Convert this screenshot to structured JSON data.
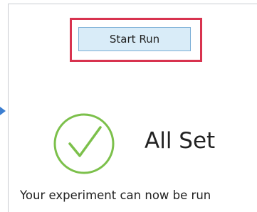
{
  "toolbar": {
    "start_run_label": "Start Run"
  },
  "status": {
    "title": "All Set",
    "message": "Your experiment can now be run",
    "icon": "checkmark-circle-icon"
  },
  "colors": {
    "highlight_border": "#d8334f",
    "button_fill": "#d9ecf8",
    "button_border": "#7aaed6",
    "check_green": "#7cc04b",
    "arrow_blue": "#3d7fd1"
  }
}
